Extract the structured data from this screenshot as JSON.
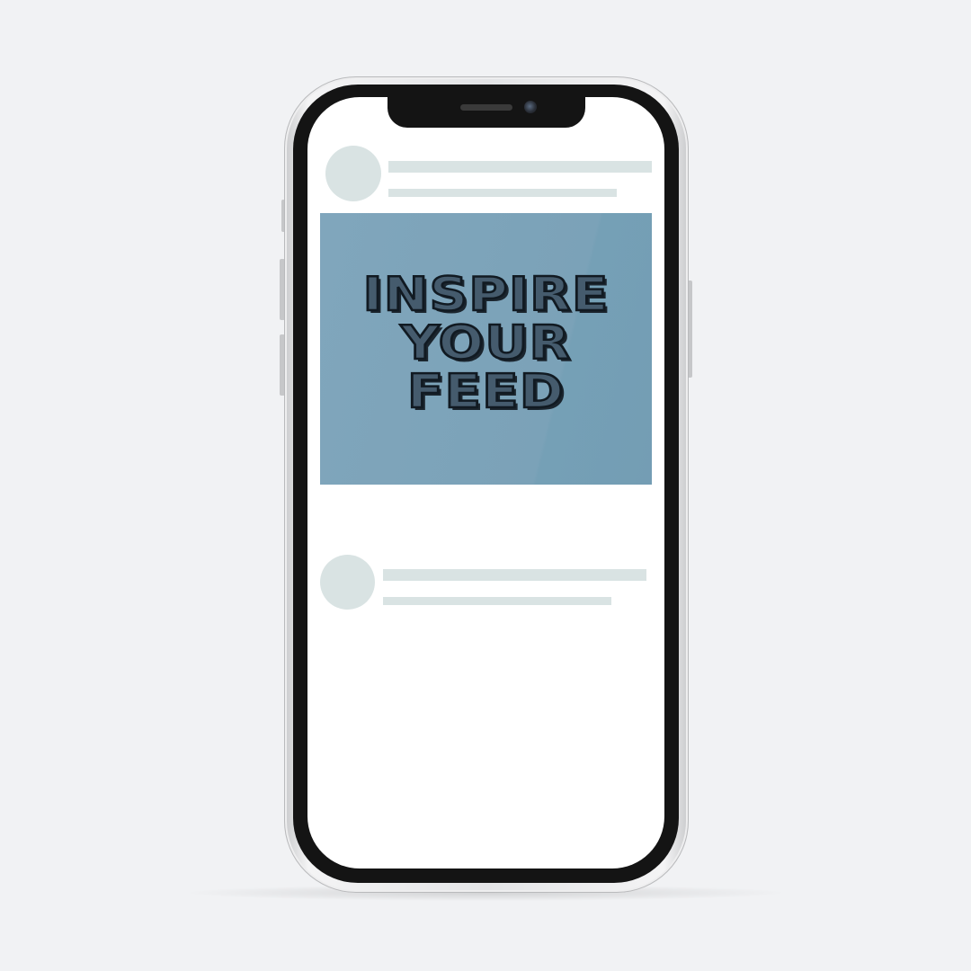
{
  "headline": {
    "line1": "INSPIRE",
    "line2": "YOUR",
    "line3": "FEED"
  },
  "colors": {
    "background": "#f1f2f4",
    "placeholder": "#d9e3e3",
    "image_bg": "#7ba2b8",
    "text_fill": "#455b6d",
    "text_outline": "#111a22"
  },
  "icons": [
    "profile-avatar-placeholder",
    "front-camera",
    "earpiece-speaker"
  ]
}
